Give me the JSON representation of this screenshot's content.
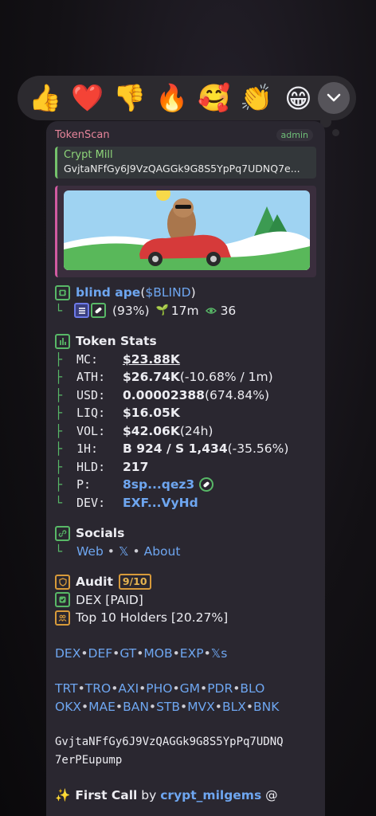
{
  "reactions": [
    {
      "emoji": "👍",
      "name": "thumbs-up"
    },
    {
      "emoji": "❤️",
      "name": "heart"
    },
    {
      "emoji": "👎",
      "name": "thumbs-down"
    },
    {
      "emoji": "🔥",
      "name": "fire"
    },
    {
      "emoji": "🥰",
      "name": "smiling-face-hearts"
    },
    {
      "emoji": "👏",
      "name": "clapping"
    },
    {
      "emoji": "😁",
      "name": "grinning"
    }
  ],
  "message": {
    "sender": "TokenScan",
    "role": "admin",
    "reply": {
      "name": "Crypt Mill",
      "text": "GvjtaNFfGy6J9VzQAGGk9G8S5YpPq7UDNQ7e..."
    },
    "token": {
      "name": "blind ape",
      "ticker_open": " (",
      "ticker": "$BLIND",
      "ticker_close": ")",
      "percent": "(93%)",
      "age": "17m",
      "views": "36"
    },
    "stats": {
      "title": "Token Stats",
      "rows": [
        {
          "label": "MC:",
          "value": "$23.88K",
          "extra": ""
        },
        {
          "label": "ATH:",
          "value": "$26.74K",
          "extra": " (-10.68% / 1m)"
        },
        {
          "label": "USD:",
          "value": "0.00002388",
          "extra": " (674.84%)"
        },
        {
          "label": "LIQ:",
          "value": "$16.05K",
          "extra": ""
        },
        {
          "label": "VOL:",
          "value": "$42.06K",
          "extra": " (24h)"
        },
        {
          "label": "1H:",
          "value": "B 924 / S 1,434",
          "extra": " (-35.56%)"
        },
        {
          "label": "HLD:",
          "value": "217",
          "extra": ""
        },
        {
          "label": "P:",
          "value": "8sp...qez3",
          "extra": ""
        },
        {
          "label": "DEV:",
          "value": "EXF...VyHd",
          "extra": ""
        }
      ]
    },
    "socials": {
      "title": "Socials",
      "web": "Web",
      "x": "𝕏",
      "about": "About",
      "dot": "•"
    },
    "audit": {
      "title": "Audit",
      "score": "9/10",
      "dex": "DEX [PAID]",
      "holders": "Top 10 Holders [20.27%]"
    },
    "links1": [
      "DEX",
      "DEF",
      "GT",
      "MOB",
      "EXP",
      "𝕏s"
    ],
    "links2": [
      "TRT",
      "TRO",
      "AXI",
      "PHO",
      "GM",
      "PDR",
      "BLO"
    ],
    "links3": [
      "OKX",
      "MAE",
      "BAN",
      "STB",
      "MVX",
      "BLX",
      "BNK"
    ],
    "contract_line1": "GvjtaNFfGy6J9VzQAGGk9G8S5YpPq7UDNQ",
    "contract_line2": "7erPEupump",
    "first_call": {
      "sparkle": "✨",
      "label": "First Call",
      "by": " by ",
      "user": "crypt_milgems",
      "suffix": " @"
    }
  },
  "colors": {
    "link": "#6ea6f0",
    "tree": "#58b867",
    "sender": "#e6849a",
    "reply_accent": "#74c16b",
    "preview_accent": "#d05aa0",
    "audit_accent": "#d79a3a"
  }
}
